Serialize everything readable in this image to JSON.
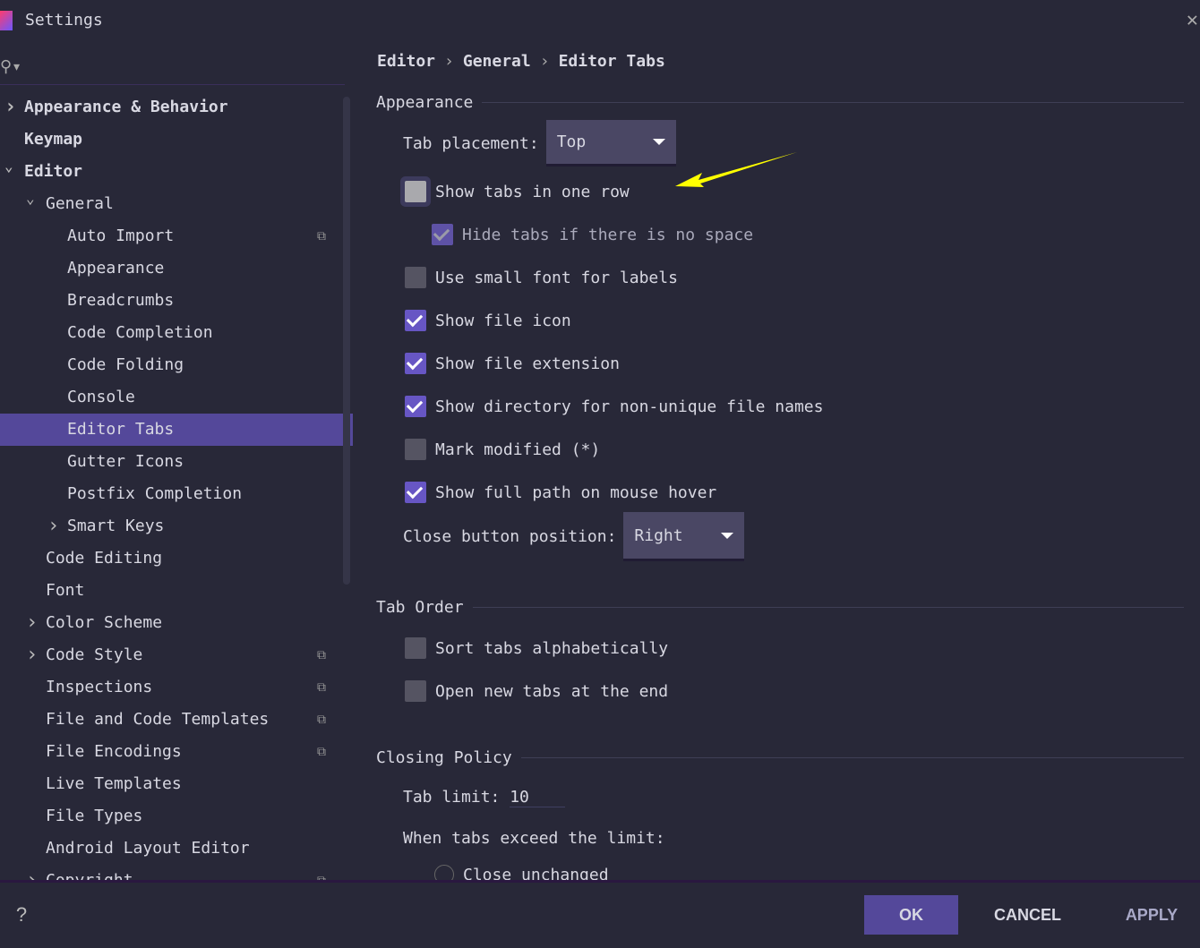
{
  "window": {
    "title": "Settings"
  },
  "breadcrumb": [
    "Editor",
    "General",
    "Editor Tabs"
  ],
  "sidebar": {
    "items": [
      {
        "label": "Appearance & Behavior",
        "level": 0,
        "chevron": "right",
        "bold": true
      },
      {
        "label": "Keymap",
        "level": 0,
        "bold": true
      },
      {
        "label": "Editor",
        "level": 0,
        "chevron": "down",
        "bold": true
      },
      {
        "label": "General",
        "level": 1,
        "chevron": "down"
      },
      {
        "label": "Auto Import",
        "level": 2,
        "copy": true
      },
      {
        "label": "Appearance",
        "level": 2
      },
      {
        "label": "Breadcrumbs",
        "level": 2
      },
      {
        "label": "Code Completion",
        "level": 2
      },
      {
        "label": "Code Folding",
        "level": 2
      },
      {
        "label": "Console",
        "level": 2
      },
      {
        "label": "Editor Tabs",
        "level": 2,
        "selected": true
      },
      {
        "label": "Gutter Icons",
        "level": 2
      },
      {
        "label": "Postfix Completion",
        "level": 2
      },
      {
        "label": "Smart Keys",
        "level": 2,
        "chevron": "right"
      },
      {
        "label": "Code Editing",
        "level": 1
      },
      {
        "label": "Font",
        "level": 1
      },
      {
        "label": "Color Scheme",
        "level": 1,
        "chevron": "right"
      },
      {
        "label": "Code Style",
        "level": 1,
        "chevron": "right",
        "copy": true
      },
      {
        "label": "Inspections",
        "level": 1,
        "copy": true
      },
      {
        "label": "File and Code Templates",
        "level": 1,
        "copy": true
      },
      {
        "label": "File Encodings",
        "level": 1,
        "copy": true
      },
      {
        "label": "Live Templates",
        "level": 1
      },
      {
        "label": "File Types",
        "level": 1
      },
      {
        "label": "Android Layout Editor",
        "level": 1
      },
      {
        "label": "Copyright",
        "level": 1,
        "chevron": "right",
        "copy": true
      }
    ]
  },
  "appearance": {
    "heading": "Appearance",
    "tab_placement_label": "Tab placement:",
    "tab_placement_value": "Top",
    "options": [
      {
        "label": "Show tabs in one row",
        "checked": false
      },
      {
        "label": "Hide tabs if there is no space",
        "checked": true,
        "disabled": true
      },
      {
        "label": "Use small font for labels",
        "checked": false
      },
      {
        "label": "Show file icon",
        "checked": true
      },
      {
        "label": "Show file extension",
        "checked": true
      },
      {
        "label": "Show directory for non-unique file names",
        "checked": true
      },
      {
        "label": "Mark modified (*)",
        "checked": false
      },
      {
        "label": "Show full path on mouse hover",
        "checked": true
      }
    ],
    "close_button_label": "Close button position:",
    "close_button_value": "Right"
  },
  "tab_order": {
    "heading": "Tab Order",
    "options": [
      {
        "label": "Sort tabs alphabetically",
        "checked": false
      },
      {
        "label": "Open new tabs at the end",
        "checked": false
      }
    ]
  },
  "closing_policy": {
    "heading": "Closing Policy",
    "tab_limit_label": "Tab limit:",
    "tab_limit_value": "10",
    "exceed_label": "When tabs exceed the limit:",
    "radio_close_unchanged": "Close unchanged"
  },
  "footer": {
    "help": "?",
    "ok": "OK",
    "cancel": "CANCEL",
    "apply": "APPLY"
  },
  "colors": {
    "accent": "#54489a",
    "background": "#282838",
    "annotation_arrow": "#ffff00"
  }
}
